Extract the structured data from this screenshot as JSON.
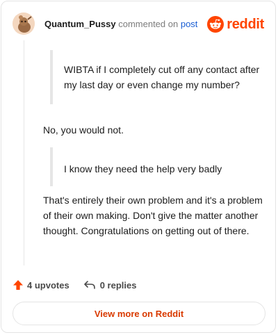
{
  "header": {
    "username": "Quantum_Pussy",
    "action_text": "commented on",
    "post_link": "post",
    "brand_name": "reddit",
    "brand_color": "#ff4500"
  },
  "comment": {
    "quote_1": "WIBTA if I completely cut off any contact after my last day or even change my number?",
    "reply_1": "No, you would not.",
    "quote_2": "I know they need the help very badly",
    "reply_2": "That's entirely their own problem and it's a problem of their own making. Don't give the matter another thought. Congratulations on getting out of there."
  },
  "footer": {
    "upvotes": "4 upvotes",
    "replies": "0 replies",
    "upvote_icon": "upvote-arrow-icon",
    "reply_icon": "reply-arrow-icon"
  },
  "cta": {
    "view_more_label": "View more on Reddit",
    "color": "#d93a00"
  }
}
